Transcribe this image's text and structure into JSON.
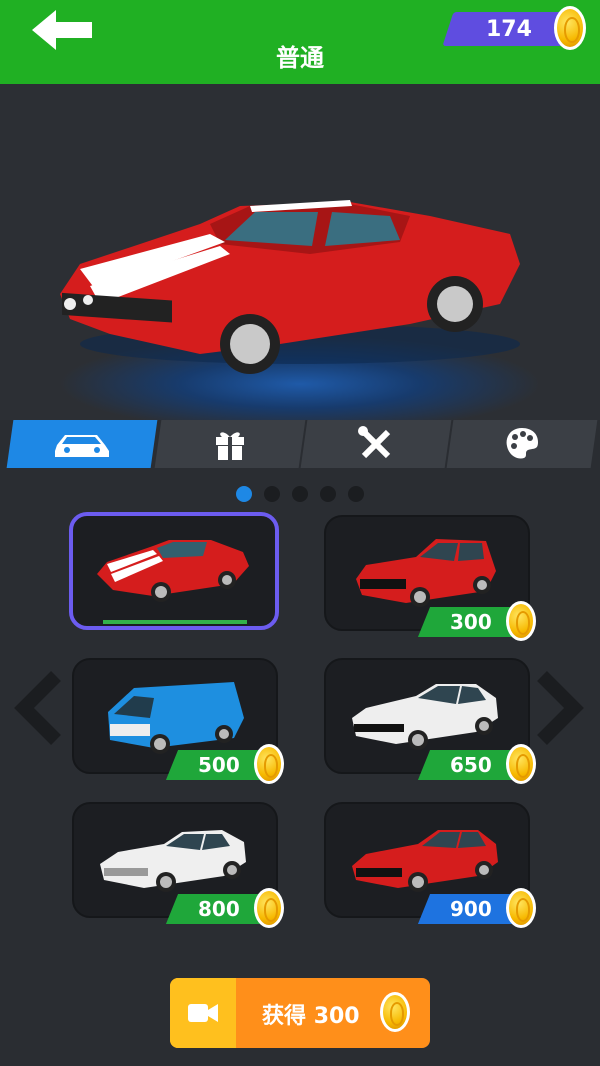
{
  "header": {
    "title": "普通",
    "coin_balance": "174",
    "colors": {
      "bar": "#20b023",
      "coin_band": "#5f4de0"
    }
  },
  "tabs": [
    {
      "icon": "car-icon",
      "active": true
    },
    {
      "icon": "gift-icon",
      "active": false
    },
    {
      "icon": "tools-icon",
      "active": false
    },
    {
      "icon": "palette-icon",
      "active": false
    }
  ],
  "pager": {
    "pages": 5,
    "current": 1
  },
  "cars": [
    {
      "name": "red muscle car",
      "selected": true,
      "price": ""
    },
    {
      "name": "red hatchback",
      "price": "300",
      "band_color": "#1fa73a"
    },
    {
      "name": "blue van",
      "price": "500",
      "band_color": "#1fa73a"
    },
    {
      "name": "white coupe",
      "price": "650",
      "band_color": "#1fa73a"
    },
    {
      "name": "white sedan",
      "price": "800",
      "band_color": "#1fa73a"
    },
    {
      "name": "red sport sedan",
      "price": "900",
      "band_color": "#1e73e0"
    }
  ],
  "watch_button": {
    "label": "获得",
    "amount": "300"
  }
}
